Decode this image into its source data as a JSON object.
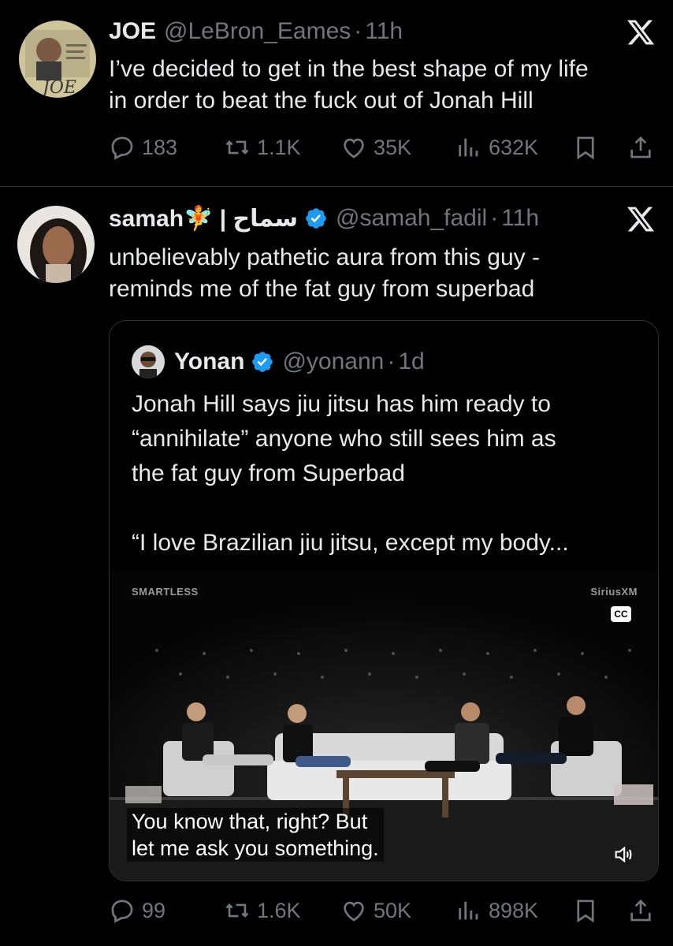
{
  "tweet1": {
    "name": "JOE",
    "handle": "@LeBron_Eames",
    "dot": "·",
    "time": "11h",
    "text_line1": "I’ve decided to get in the best shape of my life",
    "text_line2": "in order to beat the fuck out of Jonah Hill",
    "avatar_text": "JOE",
    "replies": "183",
    "reposts": "1.1K",
    "likes": "35K",
    "views": "632K"
  },
  "tweet2": {
    "name": "samah🧚 | سماح",
    "handle": "@samah_fadil",
    "dot": "·",
    "time": "11h",
    "text_line1": "unbelievably pathetic aura from this guy -",
    "text_line2": "reminds me of the fat guy from superbad",
    "replies": "99",
    "reposts": "1.6K",
    "likes": "50K",
    "views": "898K",
    "quote": {
      "name": "Yonan",
      "handle": "@yonann",
      "dot": "·",
      "time": "1d",
      "line1": "Jonah Hill says jiu jitsu has him ready to",
      "line2": "“annihilate” anyone who still sees him as",
      "line3": "the fat guy from Superbad",
      "line4": "“I love Brazilian jiu jitsu, except my body...",
      "video": {
        "brand_left": "SMARTLESS",
        "brand_right": "SiriusXM",
        "cc": "CC",
        "caption_line1": "You know that, right? But",
        "caption_line2": "let me ask you something."
      }
    }
  },
  "colors": {
    "background": "#000000",
    "text": "#e7e9ea",
    "muted": "#71767b",
    "verified": "#1d9bf0",
    "divider": "#2f3336"
  },
  "icons": [
    "x-logo-icon",
    "reply-icon",
    "repost-icon",
    "like-icon",
    "views-icon",
    "bookmark-icon",
    "share-icon",
    "verified-icon",
    "volume-icon"
  ]
}
